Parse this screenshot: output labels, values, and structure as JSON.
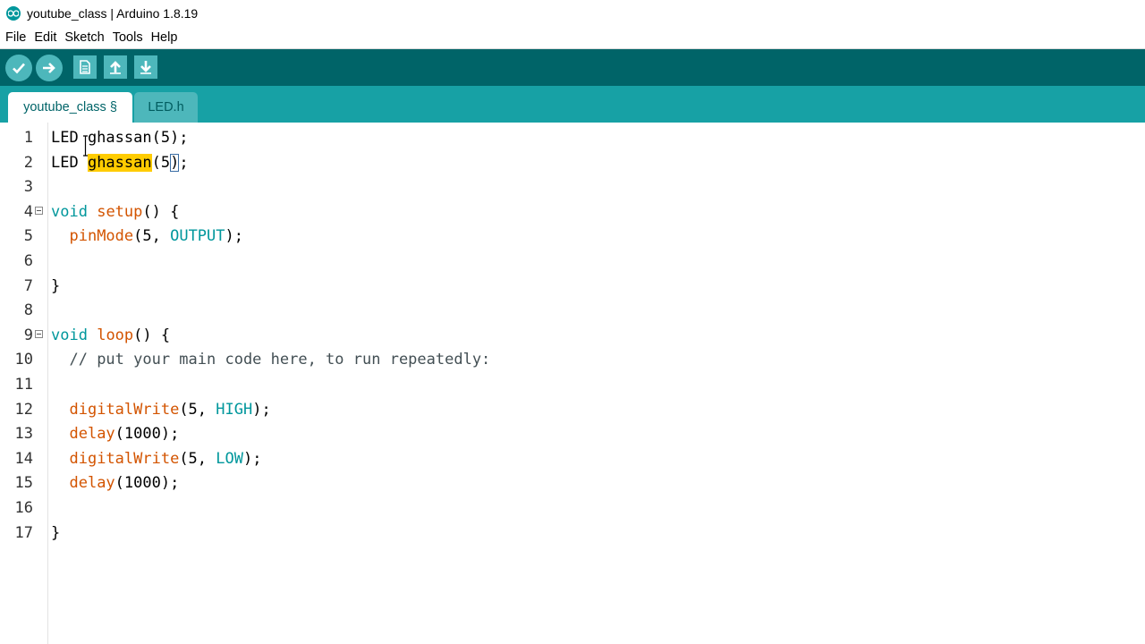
{
  "window": {
    "title": "youtube_class | Arduino 1.8.19"
  },
  "menu": [
    "File",
    "Edit",
    "Sketch",
    "Tools",
    "Help"
  ],
  "toolbar": {
    "verify_icon": "check-icon",
    "upload_icon": "arrow-right-icon",
    "new_icon": "new-file-icon",
    "open_icon": "arrow-up-icon",
    "save_icon": "arrow-down-icon"
  },
  "tabs": [
    {
      "label": "youtube_class §",
      "active": true
    },
    {
      "label": "LED.h",
      "active": false
    }
  ],
  "editor": {
    "lines": [
      {
        "num": "1",
        "text": "LED ghassan(5);"
      },
      {
        "num": "2",
        "text": "LED ghassan(5);",
        "highlight": "ghassan"
      },
      {
        "num": "3",
        "text": ""
      },
      {
        "num": "4",
        "text": "void setup() {",
        "fold": true
      },
      {
        "num": "5",
        "text": "  pinMode(5, OUTPUT);"
      },
      {
        "num": "6",
        "text": ""
      },
      {
        "num": "7",
        "text": "}"
      },
      {
        "num": "8",
        "text": ""
      },
      {
        "num": "9",
        "text": "void loop() {",
        "fold": true
      },
      {
        "num": "10",
        "text": "  // put your main code here, to run repeatedly:"
      },
      {
        "num": "11",
        "text": ""
      },
      {
        "num": "12",
        "text": "  digitalWrite(5, HIGH);"
      },
      {
        "num": "13",
        "text": "  delay(1000);"
      },
      {
        "num": "14",
        "text": "  digitalWrite(5, LOW);"
      },
      {
        "num": "15",
        "text": "  delay(1000);"
      },
      {
        "num": "16",
        "text": ""
      },
      {
        "num": "17",
        "text": "}"
      }
    ]
  },
  "colors": {
    "toolbar": "#006468",
    "tabbar": "#17a1a5",
    "button": "#4db7bb",
    "keyword": "#00979c",
    "function": "#d35400",
    "highlight": "#ffcc00"
  }
}
